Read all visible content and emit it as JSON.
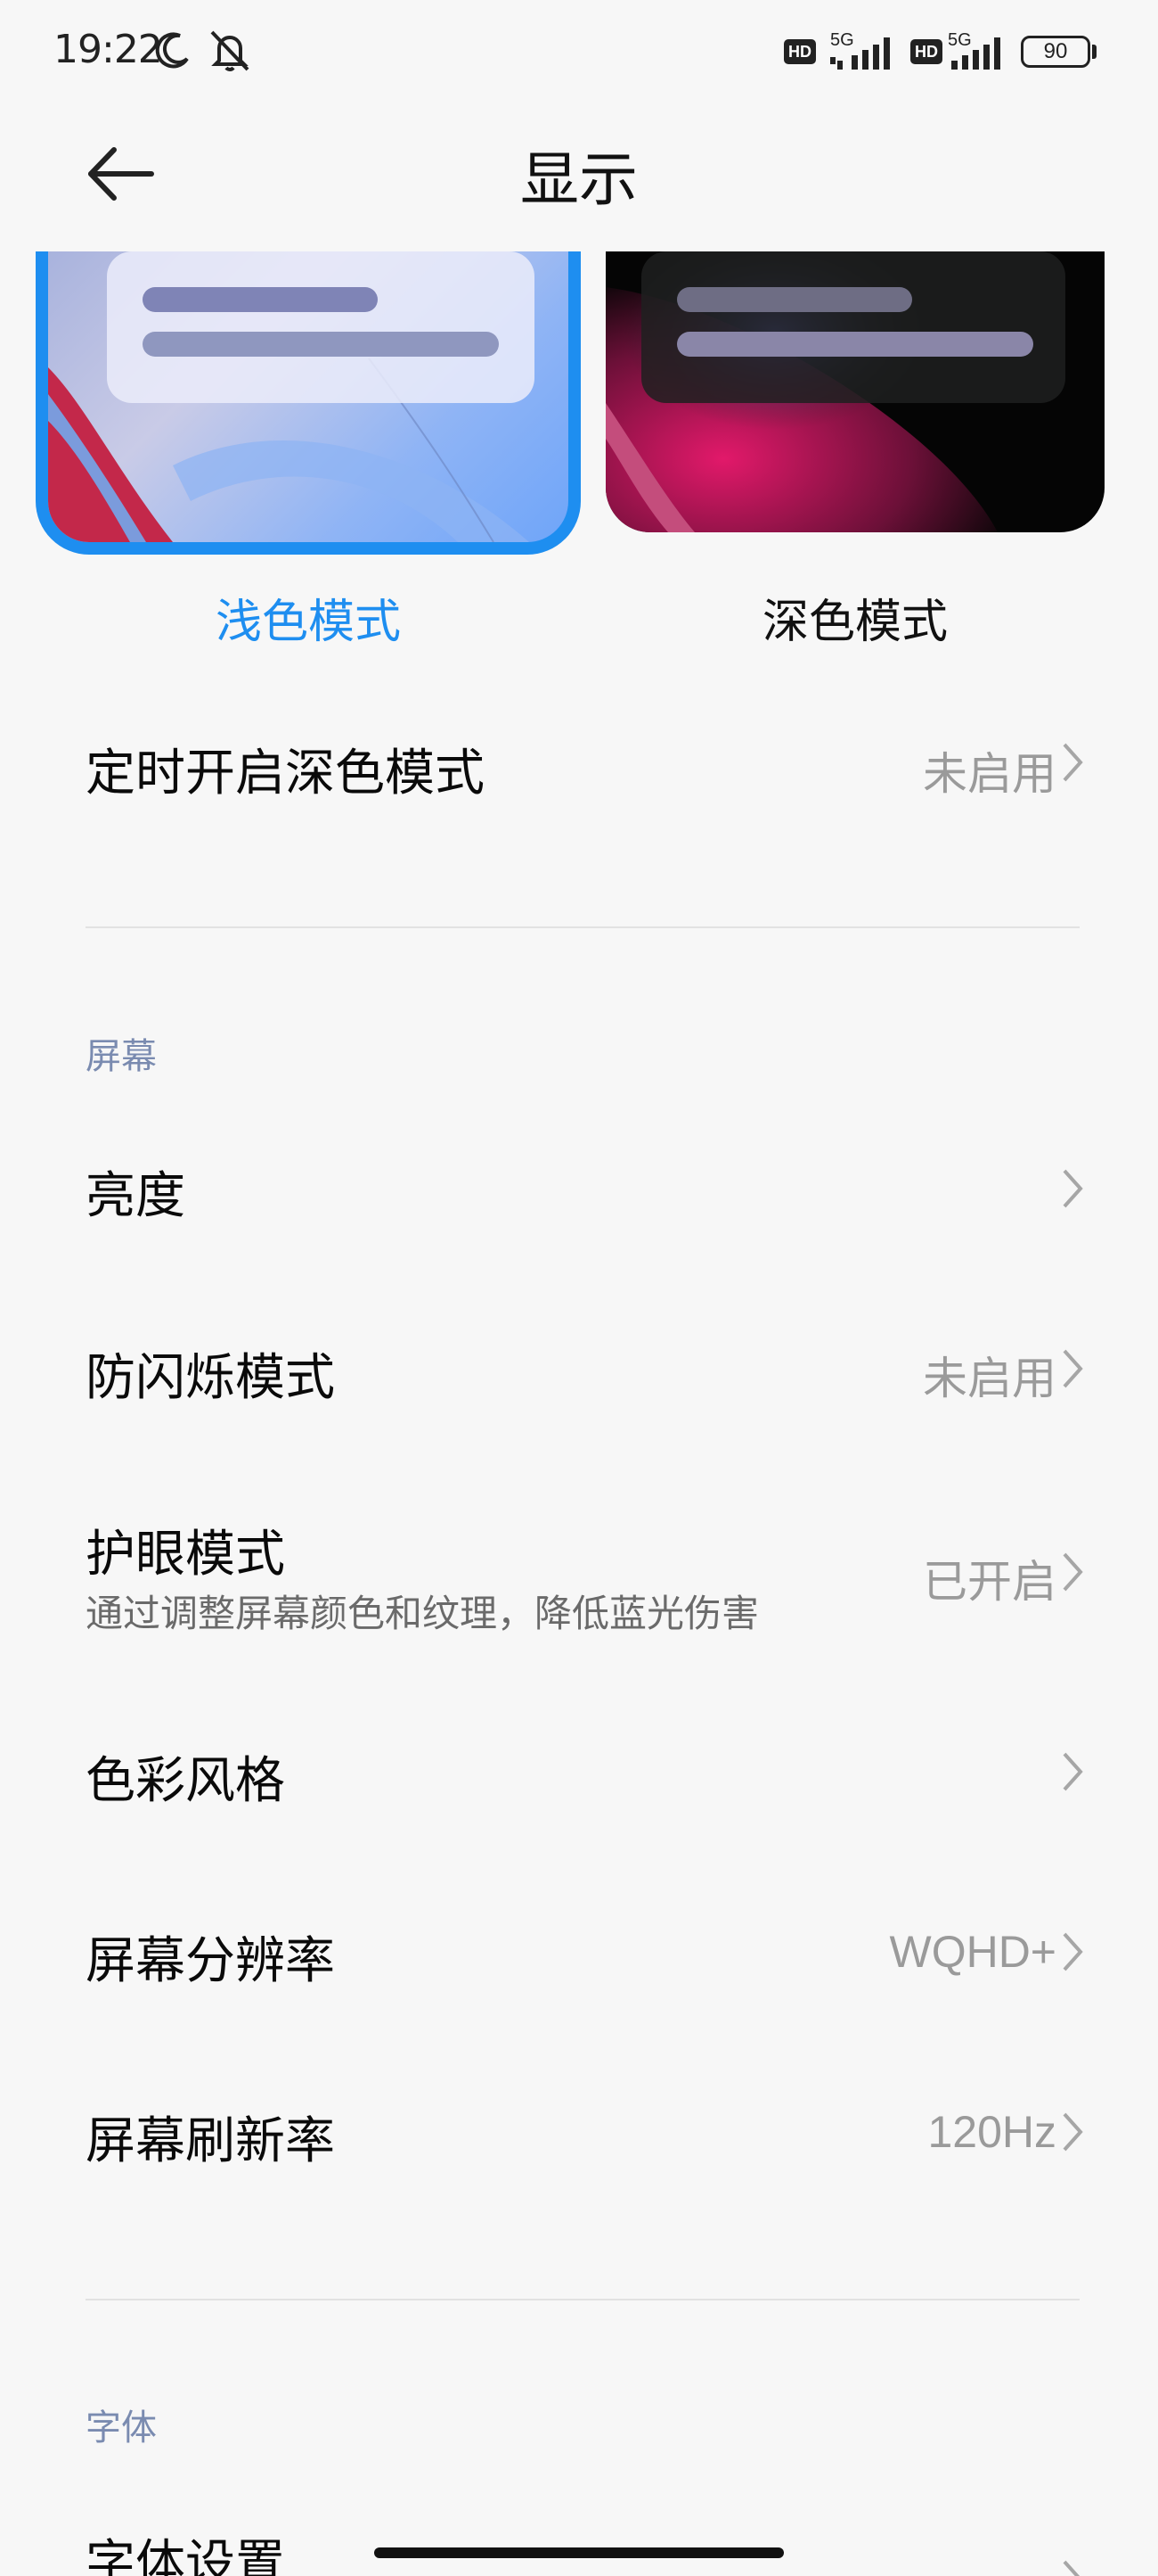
{
  "status_bar": {
    "time": "19:22",
    "icons": [
      "moon-icon",
      "mute-icon",
      "hd-badge",
      "5g-signal-icon",
      "hd-badge",
      "5g-signal-icon",
      "battery-icon"
    ],
    "hd_label": "HD",
    "network_label": "5G",
    "battery": "90"
  },
  "header": {
    "title": "显示",
    "back_icon": "back-arrow-icon"
  },
  "theme": {
    "light_label": "浅色模式",
    "dark_label": "深色模式",
    "selected": "浅色模式",
    "accent_color": "#1e8ef0"
  },
  "schedule_dark": {
    "title": "定时开启深色模式",
    "value": "未启用"
  },
  "screen_section": {
    "label": "屏幕",
    "items": [
      {
        "title": "亮度",
        "value": ""
      },
      {
        "title": "防闪烁模式",
        "value": "未启用"
      },
      {
        "title": "护眼模式",
        "subtitle": "通过调整屏幕颜色和纹理，降低蓝光伤害",
        "value": "已开启"
      },
      {
        "title": "色彩风格",
        "value": ""
      },
      {
        "title": "屏幕分辨率",
        "value": "WQHD+"
      },
      {
        "title": "屏幕刷新率",
        "value": "120Hz"
      }
    ]
  },
  "font_section": {
    "label": "字体",
    "items": [
      {
        "title": "字体设置",
        "value": ""
      }
    ]
  }
}
